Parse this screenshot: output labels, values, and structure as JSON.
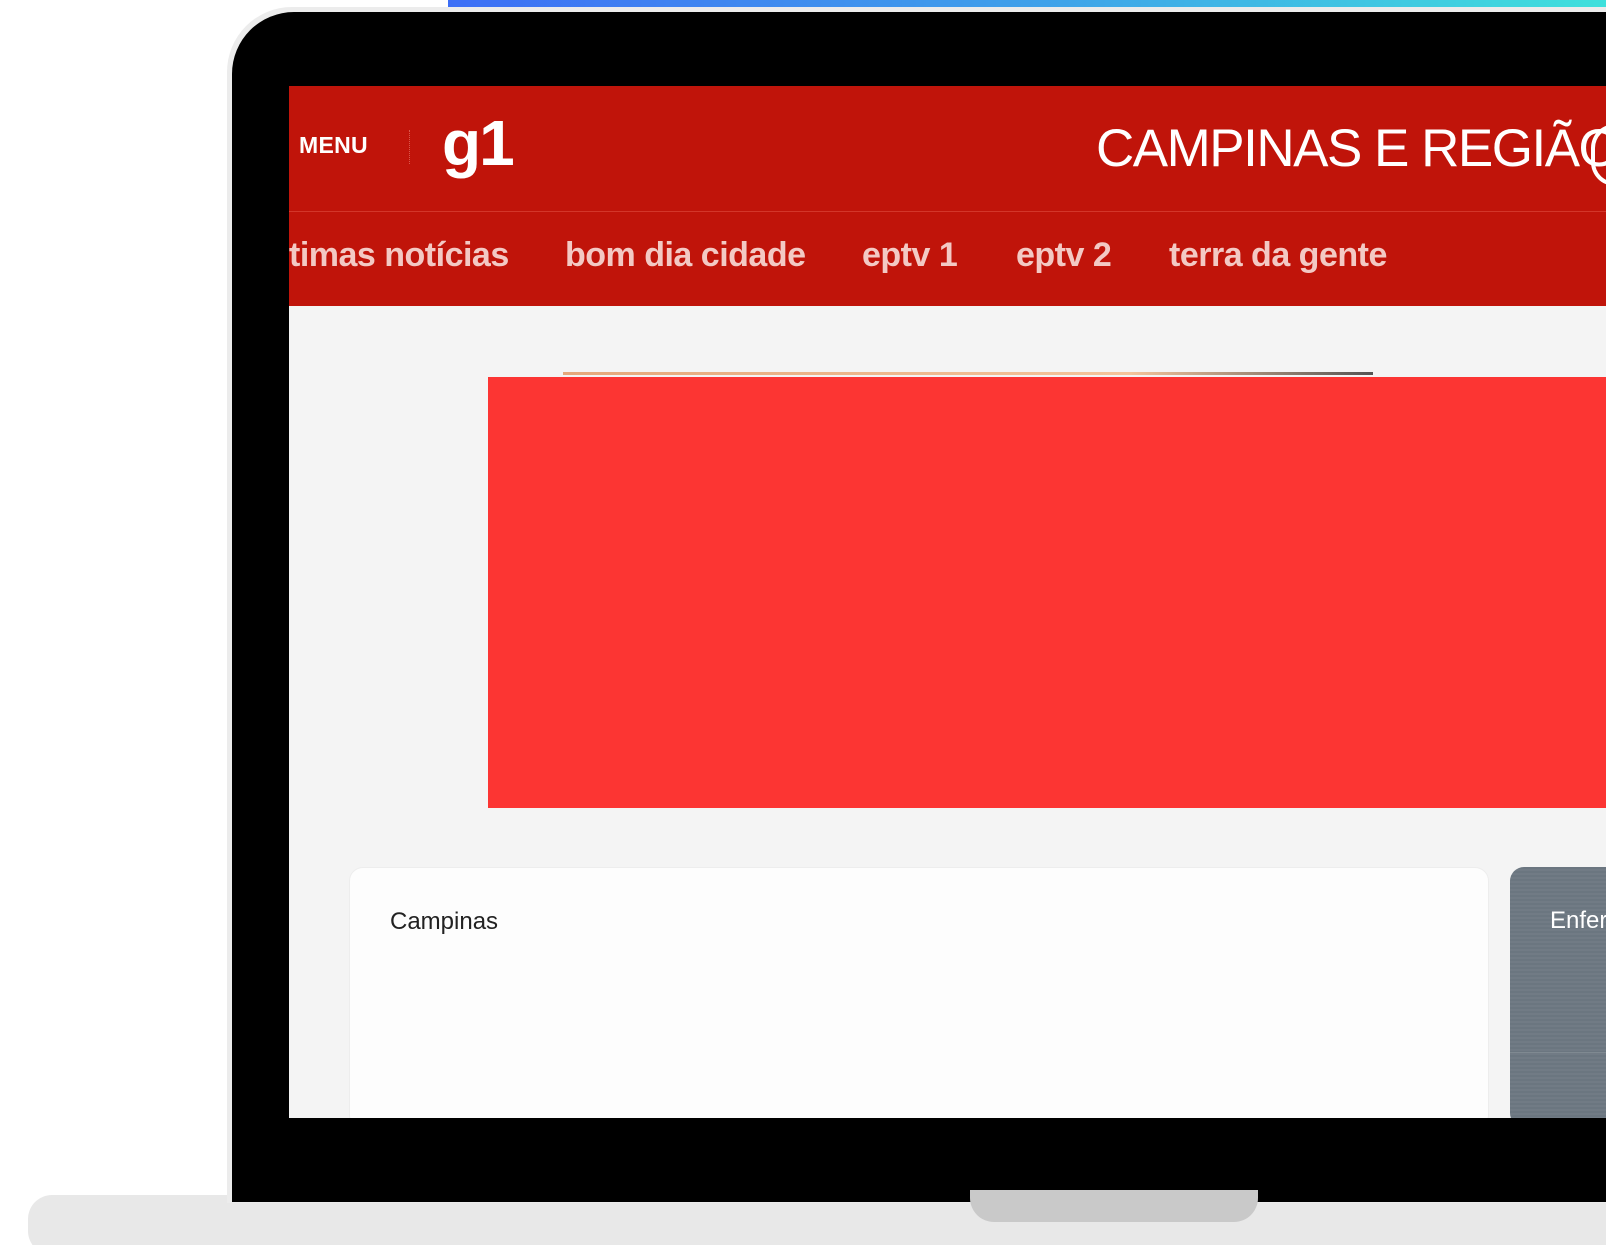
{
  "header": {
    "menu_label": "MENU",
    "logo": "g1",
    "region_title": "CAMPINAS E REGIÃO"
  },
  "nav": {
    "items": [
      {
        "label": "timas notícias"
      },
      {
        "label": "bom dia cidade"
      },
      {
        "label": "eptv 1"
      },
      {
        "label": "eptv 2"
      },
      {
        "label": "terra da gente"
      }
    ]
  },
  "cards": [
    {
      "title": "Campinas"
    },
    {
      "title": "Enfer"
    }
  ],
  "colors": {
    "brand_red": "#c0140a",
    "nav_text": "#f3c9c4",
    "banner_red": "#fc3533",
    "page_bg": "#f4f4f4",
    "dark_card": "#6b7680"
  }
}
